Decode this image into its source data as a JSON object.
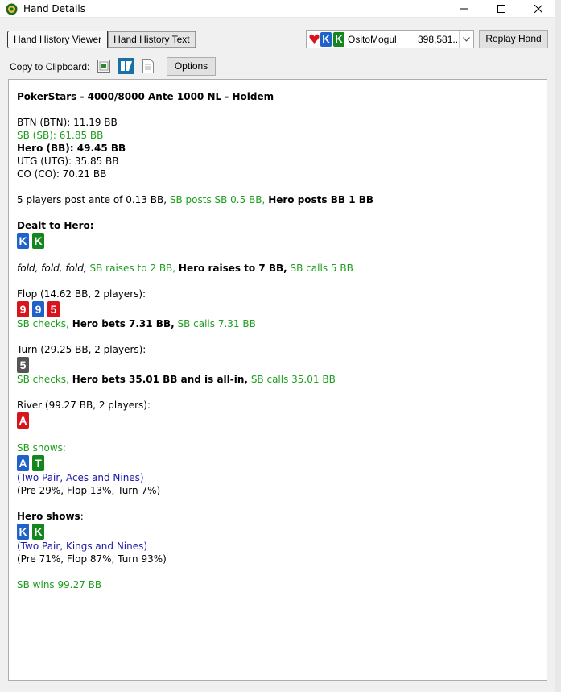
{
  "window": {
    "title": "Hand Details"
  },
  "toolbar": {
    "tabs": [
      "Hand History Viewer",
      "Hand History Text"
    ],
    "player": {
      "cards": [
        "K",
        "K"
      ],
      "name": "OsitoMogul",
      "stack": "398,581..."
    },
    "replay_label": "Replay Hand",
    "copy_label": "Copy to Clipboard:",
    "options_label": "Options"
  },
  "hand": {
    "header": "PokerStars - 4000/8000 Ante 1000 NL - Holdem",
    "players": {
      "btn": "BTN (BTN): 11.19 BB",
      "sb": "SB (SB): 61.85 BB",
      "hero": "Hero (BB): 49.45 BB",
      "utg": "UTG (UTG): 35.85 BB",
      "co": "CO (CO): 70.21 BB"
    },
    "post_ante": "5 players post ante of 0.13 BB,",
    "post_sb": "SB posts SB 0.5 BB,",
    "post_hero": "Hero posts BB 1 BB",
    "dealt_label": "Dealt to Hero:",
    "dealt_cards": [
      "K",
      "K"
    ],
    "preflop": {
      "fold1": "fold,",
      "fold2": "fold,",
      "fold3": "fold,",
      "sb_raise": "SB raises to 2 BB,",
      "hero_raise": "Hero raises to 7 BB,",
      "sb_call": "SB calls 5 BB"
    },
    "flop": {
      "label": "Flop (14.62 BB, 2 players):",
      "cards": [
        "9",
        "9",
        "5"
      ],
      "sb_check": "SB checks,",
      "hero_bet": "Hero bets 7.31 BB,",
      "sb_call": "SB calls 7.31 BB"
    },
    "turn": {
      "label": "Turn (29.25 BB, 2 players):",
      "cards": [
        "5"
      ],
      "sb_check": "SB checks,",
      "hero_bet": "Hero bets 35.01 BB and is all-in,",
      "sb_call": "SB calls 35.01 BB"
    },
    "river": {
      "label": "River (99.27 BB, 2 players):",
      "cards": [
        "A"
      ]
    },
    "sb_show": {
      "label": "SB shows:",
      "cards": [
        "A",
        "T"
      ],
      "hand": "(Two Pair, Aces and Nines)",
      "equity": "(Pre 29%, Flop 13%, Turn 7%)"
    },
    "hero_show": {
      "label": "Hero shows",
      "colon": ":",
      "cards": [
        "K",
        "K"
      ],
      "hand": "(Two Pair, Kings and Nines)",
      "equity": "(Pre 71%, Flop 87%, Turn 93%)"
    },
    "result": "SB wins 99.27 BB"
  },
  "colors": {
    "green_text": "#1e9e1e",
    "blue_text": "#1818a8",
    "club": "#14861e",
    "spade": "#1f62c9",
    "heart": "#d6151d",
    "neutral": "#555555"
  }
}
